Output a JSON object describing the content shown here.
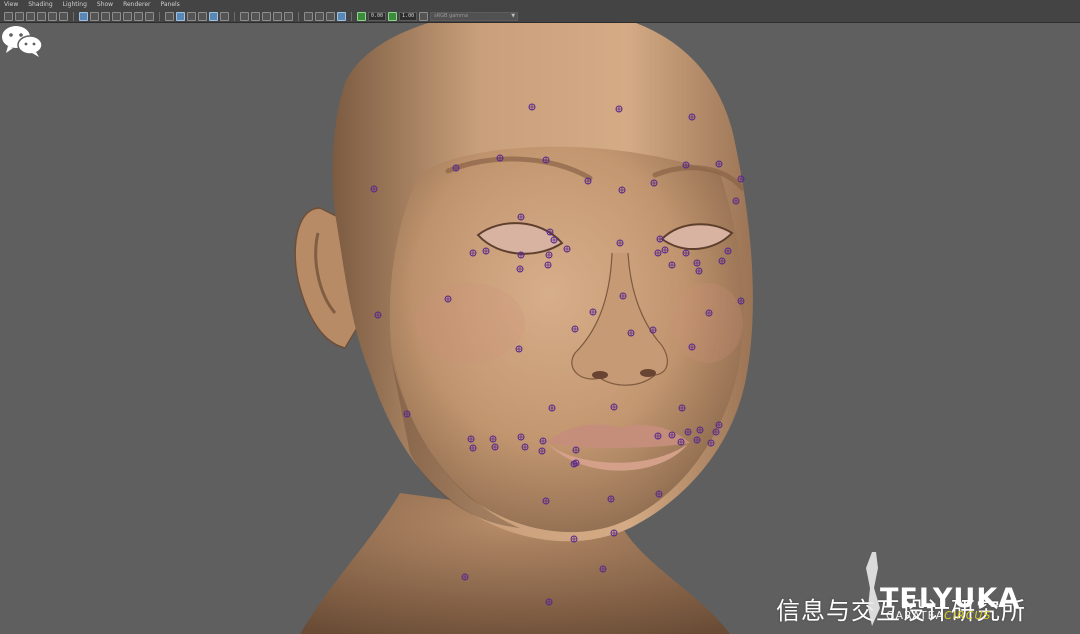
{
  "menubar": {
    "items": [
      "View",
      "Shading",
      "Lighting",
      "Show",
      "Renderer",
      "Panels"
    ]
  },
  "toolbar": {
    "field_1": "0.00",
    "field_2": "1.00",
    "colorspace": "sRGB gamma"
  },
  "viewport": {
    "background_color": "#5f5f5f",
    "locator_color": "#5a2a8c"
  },
  "watermark": {
    "wechat_text": "信息与交互设计研究所",
    "logo_main": "TELYUKA",
    "logo_sub_1": "GARATEA",
    "logo_sub_2": "CIRCUS",
    "logo_accent_color": "#d9cd22"
  }
}
